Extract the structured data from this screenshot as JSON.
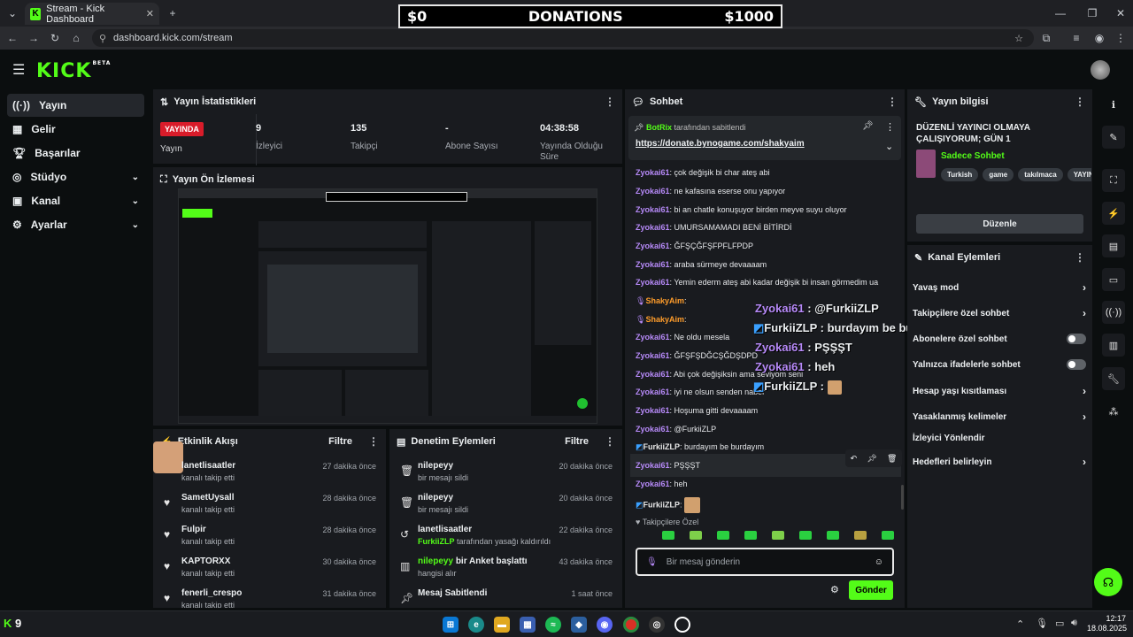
{
  "browser": {
    "tab_title": "Stream - Kick Dashboard",
    "url": "dashboard.kick.com/stream"
  },
  "donations": {
    "min": "$0",
    "label": "DONATIONS",
    "max": "$1000"
  },
  "app": {
    "logo": "KICK",
    "logo_sup": "BETA"
  },
  "sidebar": {
    "items": [
      {
        "label": "Yayın",
        "icon": "broadcast-icon"
      },
      {
        "label": "Gelir",
        "icon": "revenue-icon"
      },
      {
        "label": "Başarılar",
        "icon": "trophy-icon"
      },
      {
        "label": "Stüdyo",
        "icon": "studio-icon"
      },
      {
        "label": "Kanal",
        "icon": "channel-icon"
      },
      {
        "label": "Ayarlar",
        "icon": "settings-icon"
      }
    ]
  },
  "stats": {
    "title": "Yayın İstatistikleri",
    "live_badge": "YAYINDA",
    "live_label": "Yayın",
    "viewers": "9",
    "viewers_label": "İzleyici",
    "followers": "135",
    "followers_label": "Takipçi",
    "subs": "-",
    "subs_label": "Abone Sayısı",
    "duration": "04:38:58",
    "duration_label": "Yayında Olduğu Süre"
  },
  "preview": {
    "title": "Yayın Ön İzlemesi"
  },
  "activity": {
    "title": "Etkinlik Akışı",
    "filter": "Filtre",
    "items": [
      {
        "user": "lanetlisaatler",
        "action": "kanalı takip etti",
        "time": "27 dakika önce"
      },
      {
        "user": "SametUysall",
        "action": "kanalı takip etti",
        "time": "28 dakika önce"
      },
      {
        "user": "Fulpir",
        "action": "kanalı takip etti",
        "time": "28 dakika önce"
      },
      {
        "user": "KAPTORXX",
        "action": "kanalı takip etti",
        "time": "30 dakika önce"
      },
      {
        "user": "fenerli_crespo",
        "action": "kanalı takip etti",
        "time": "31 dakika önce"
      }
    ]
  },
  "moderation": {
    "title": "Denetim Eylemleri",
    "filter": "Filtre",
    "items": [
      {
        "user": "nilepeyy",
        "action": "bir mesajı sildi",
        "time": "20 dakika önce"
      },
      {
        "user": "nilepeyy",
        "action": "bir mesajı sildi",
        "time": "20 dakika önce"
      },
      {
        "user": "lanetlisaatler",
        "action_user": "FurkiiZLP",
        "action": "tarafından yasağı kaldırıldı",
        "time": "22 dakika önce"
      },
      {
        "user": "nilepeyy",
        "title_suffix": "bir Anket başlattı",
        "action": "hangisi alır",
        "time": "43 dakika önce"
      },
      {
        "user": "Mesaj Sabitlendi",
        "action": "",
        "time": "1 saat önce"
      }
    ]
  },
  "chat": {
    "title": "Sohbet",
    "pinned_user": "BotRix",
    "pinned_by": "tarafından sabitlendi",
    "pinned_link": "https://donate.bynogame.com/shakyaim",
    "messages": [
      {
        "user": "Zyokai61",
        "text": "çok değişik bi char ateş abi"
      },
      {
        "user": "Zyokai61",
        "text": "ne kafasına eserse onu yapıyor"
      },
      {
        "user": "Zyokai61",
        "text": "bi an chatle konuşuyor birden meyve suyu oluyor"
      },
      {
        "user": "Zyokai61",
        "text": "UMURSAMAMADI BENİ BİTİRDİ"
      },
      {
        "user": "Zyokai61",
        "text": "ĞFŞÇĞFŞFPFLFPDP"
      },
      {
        "user": "Zyokai61",
        "text": "araba sürmeye devaaaam"
      },
      {
        "user": "Zyokai61",
        "text": "Yemin ederm ateş abi kadar değişik bi insan görmedim ua"
      },
      {
        "user": "ShakyAim",
        "text": ""
      },
      {
        "user": "ShakyAim",
        "text": ""
      },
      {
        "user": "Zyokai61",
        "text": "Ne oldu mesela"
      },
      {
        "user": "Zyokai61",
        "text": "ĞFŞFŞDĞCŞĞDŞDPD"
      },
      {
        "user": "Zyokai61",
        "text": "Abi çok değişiksin ama seviyom seni"
      },
      {
        "user": "Zyokai61",
        "text": "iyi ne olsun senden naber"
      },
      {
        "user": "Zyokai61",
        "text": "Hoşuma gitti devaaaam"
      },
      {
        "user": "Zyokai61",
        "text": "@FurkiiZLP"
      },
      {
        "user": "FurkiiZLP",
        "text": "burdayım be burdayım"
      },
      {
        "user": "Zyokai61",
        "text": "PŞŞŞT"
      },
      {
        "user": "Zyokai61",
        "text": "heh"
      },
      {
        "user": "FurkiiZLP",
        "text": ""
      }
    ],
    "overlay": [
      {
        "user": "Zyokai61",
        "text": ": @FurkiiZLP"
      },
      {
        "user": "FurkiiZLP",
        "text": ": burdayım be burdayım"
      },
      {
        "user": "Zyokai61",
        "text": ": PŞŞŞT"
      },
      {
        "user": "Zyokai61",
        "text": ": heh"
      },
      {
        "user": "FurkiiZLP",
        "text": ":"
      }
    ],
    "followers_only": "Takipçilere Özel",
    "input_placeholder": "Bir mesaj gönderin",
    "send": "Gönder"
  },
  "info": {
    "title": "Yayın bilgisi",
    "stream_title": "DÜZENLİ YAYINCI OLMAYA ÇALIŞIYORUM; GÜN 1",
    "category": "Sadece Sohbet",
    "tags": [
      "Turkish",
      "game",
      "takılmaca",
      "YAYIN"
    ],
    "edit": "Düzenle"
  },
  "channel_actions": {
    "title": "Kanal Eylemleri",
    "items": [
      {
        "label": "Yavaş mod",
        "kind": "arrow"
      },
      {
        "label": "Takipçilere özel sohbet",
        "kind": "arrow"
      },
      {
        "label": "Abonelere özel sohbet",
        "kind": "toggle"
      },
      {
        "label": "Yalnızca ifadelerle sohbet",
        "kind": "toggle"
      },
      {
        "label": "Hesap yaşı kısıtlaması",
        "kind": "arrow"
      },
      {
        "label": "Yasaklanmış kelimeler",
        "kind": "arrow"
      },
      {
        "label": "İzleyici Yönlendir",
        "kind": "none"
      },
      {
        "label": "Hedefleri belirleyin",
        "kind": "arrow"
      }
    ]
  },
  "taskbar": {
    "kick_count": "9",
    "time": "12:17",
    "date": "18.08.2025"
  },
  "colors": {
    "accent": "#53fc18",
    "chat_user": "#b78af9",
    "live": "#d91c2a"
  }
}
